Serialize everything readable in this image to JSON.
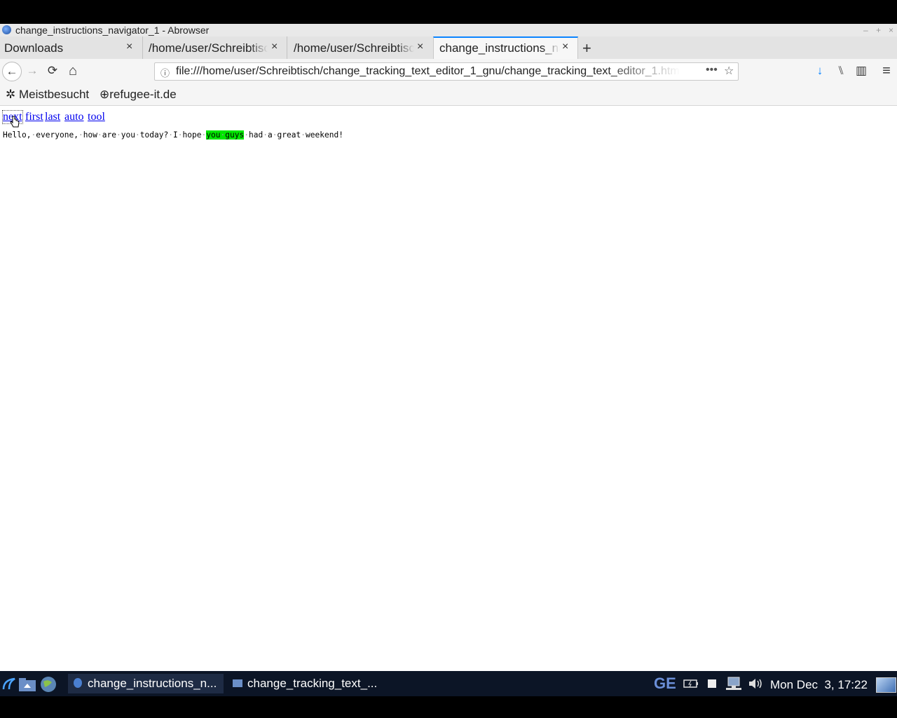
{
  "window": {
    "title": "change_instructions_navigator_1 - Abrowser",
    "controls": [
      "–",
      "+",
      "×"
    ]
  },
  "tabs": [
    {
      "label": "Downloads",
      "active": false
    },
    {
      "label": "/home/user/Schreibtisch",
      "active": false
    },
    {
      "label": "/home/user/Schreibtisch",
      "active": false
    },
    {
      "label": "change_instructions_navigator_1",
      "active": true
    }
  ],
  "tab_close": "×",
  "new_tab": "+",
  "navbar": {
    "back": "←",
    "forward": "→",
    "reload": "⟳",
    "home": "⌂",
    "url": "file:///home/user/Schreibtisch/change_tracking_text_editor_1_gnu/change_tracking_text_editor_1.html",
    "info_icon": "ⓘ",
    "page_actions": "•••",
    "bookmark_star": "☆"
  },
  "toolbar_icons": {
    "download": "↓",
    "library": "⑊",
    "sidebar": "▥",
    "menu": "≡"
  },
  "bookmarks": [
    {
      "icon": "✲",
      "label": "Meistbesucht"
    },
    {
      "icon": "⊕",
      "label": "refugee-it.de"
    }
  ],
  "page": {
    "links": [
      "next",
      "first",
      "last",
      "auto",
      "tool"
    ],
    "text_before": "Hello, everyone, how are you today? I hope ",
    "highlight": "you guys",
    "text_after": " had a great weekend!",
    "highlight_color": "#00e600"
  },
  "taskbar": {
    "windows": [
      {
        "label": "change_instructions_n...",
        "active": true
      },
      {
        "label": "change_tracking_text_...",
        "active": false
      }
    ],
    "keyboard_layout": "GE",
    "clock": "Mon Dec  3, 17:22"
  },
  "colors": {
    "link": "#0000ee",
    "tab_accent": "#0a84ff",
    "taskbar_bg": "#0c1526",
    "download_icon": "#0a84ff"
  }
}
